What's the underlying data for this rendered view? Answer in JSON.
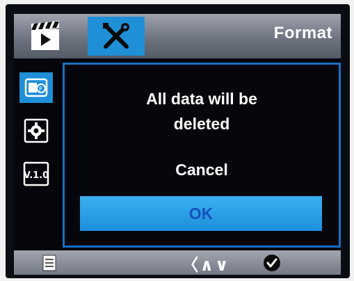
{
  "header": {
    "title": "Format",
    "tabs": [
      {
        "icon": "movie-clapper-icon",
        "selected": false
      },
      {
        "icon": "tools-icon",
        "selected": true
      }
    ]
  },
  "sidebar": {
    "items": [
      {
        "icon": "sd-card-format-icon",
        "selected": true
      },
      {
        "icon": "settings-gear-icon",
        "selected": false
      },
      {
        "icon": "version-icon",
        "label": "V.1.0",
        "selected": false
      }
    ]
  },
  "dialog": {
    "message_line1": "All data will be",
    "message_line2": "deleted",
    "cancel_label": "Cancel",
    "ok_label": "OK",
    "selected_option": "OK"
  },
  "footer": {
    "nav_symbols": "〈∧∨",
    "menu_icon": "menu-list-icon",
    "confirm_icon": "checkmark-icon"
  },
  "colors": {
    "accent": "#1f8fd8",
    "dialog_border": "#1a6fc4",
    "ok_text": "#1550b8",
    "background": "#05060b"
  }
}
